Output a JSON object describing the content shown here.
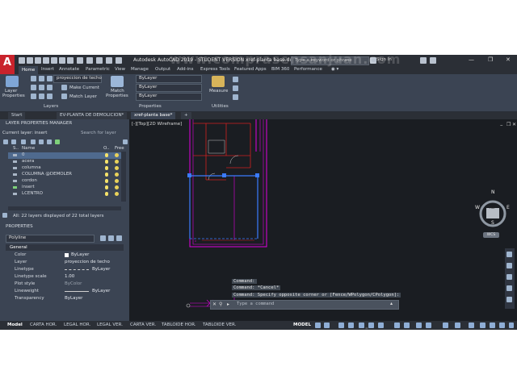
{
  "app": {
    "title": "Autodesk AutoCAD 2019 - STUDENT VERSION    xref-planta base.dwg",
    "search_placeholder": "Type a keyword or phrase",
    "signin": "Sign In",
    "logo_letter": "A"
  },
  "ribbon_tabs": [
    "Home",
    "Insert",
    "Annotate",
    "Parametric",
    "View",
    "Manage",
    "Output",
    "Add-ins",
    "Express Tools",
    "Featured Apps",
    "BIM 360",
    "Performance"
  ],
  "ribbon": {
    "layer_properties": [
      "Layer",
      "Properties"
    ],
    "layer_combo": "proyeccion de techo",
    "make_current": "Make Current",
    "match_layer": "Match Layer",
    "match_properties": [
      "Match",
      "Properties"
    ],
    "bylayer": "ByLayer",
    "measure": "Measure",
    "groups": {
      "layers": "Layers",
      "properties": "Properties",
      "utilities": "Utilities"
    }
  },
  "file_tabs": [
    "Start",
    "EV-PLANTA DE DEMOLICION*",
    "xref-planta base*"
  ],
  "layer_manager": {
    "title": "LAYER PROPERTIES MANAGER",
    "current_layer": "Current layer: insert",
    "search_placeholder": "Search for layer",
    "headers": [
      "S..",
      "Name",
      "O..",
      "Free"
    ],
    "layers": [
      "0",
      "acera",
      "columna",
      "COLUMNA @DEMOLER",
      "cordon",
      "insert",
      "LCENTRO"
    ],
    "footer": "All: 22 layers displayed of 22 total layers"
  },
  "properties_panel": {
    "title": "PROPERTIES",
    "selection": "Polyline",
    "section": "General",
    "rows": [
      {
        "label": "Color",
        "value": "ByLayer"
      },
      {
        "label": "Layer",
        "value": "proyeccion de techo"
      },
      {
        "label": "Linetype",
        "value": "ByLayer"
      },
      {
        "label": "Linetype scale",
        "value": "1.00"
      },
      {
        "label": "Plot style",
        "value": "ByColor"
      },
      {
        "label": "Lineweight",
        "value": "ByLayer"
      },
      {
        "label": "Transparency",
        "value": "ByLayer"
      }
    ]
  },
  "viewport": {
    "label": "[-][Top][2D Wireframe]",
    "compass": {
      "n": "N",
      "s": "S",
      "e": "E",
      "w": "W",
      "top": "TOP"
    },
    "wcs": "WCS"
  },
  "command": {
    "history": [
      "Command:",
      "Command: *Cancel*",
      "Command: Specify opposite corner or [Fence/WPolygon/CPolygon]:"
    ],
    "placeholder": "Type a command"
  },
  "layout_tabs": [
    "Model",
    "CARTA HOR.",
    "LEGAL HOR.",
    "LEGAL VER.",
    "CARTA VER.",
    "TABLOIDE HOR.",
    "TABLOIDE VER."
  ],
  "status": {
    "model": "MODEL"
  },
  "watermark": "www.comprasensanjuan.com"
}
